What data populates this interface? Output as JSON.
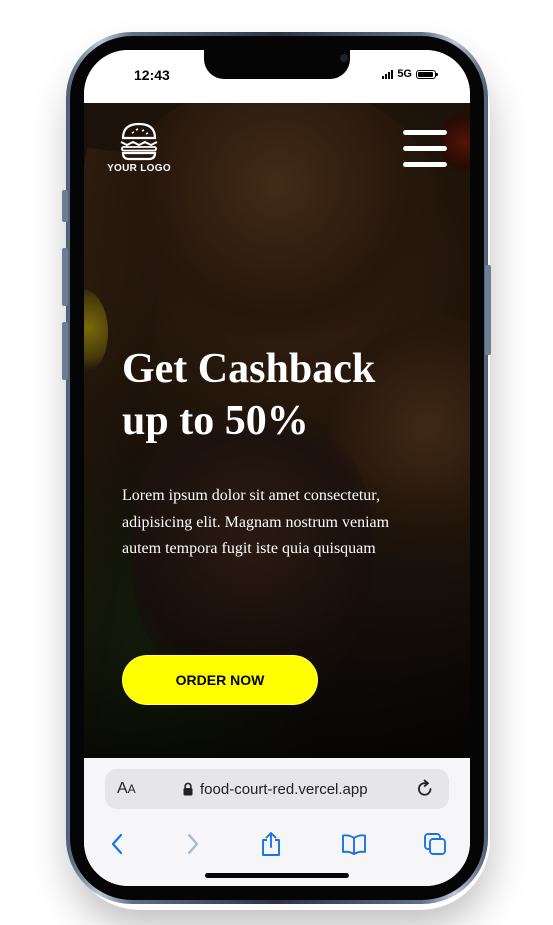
{
  "status_bar": {
    "time": "12:43",
    "network": "5G"
  },
  "hero": {
    "logo_text": "YOUR LOGO",
    "headline_line1": "Get Cashback",
    "headline_line2": "up to 50%",
    "description": "Lorem ipsum dolor sit amet consectetur, adipisicing elit. Magnam nostrum veniam autem tempora fugit iste quia quisquam",
    "cta_label": "ORDER NOW"
  },
  "browser": {
    "text_size_large": "A",
    "text_size_small": "A",
    "url": "food-court-red.vercel.app"
  },
  "colors": {
    "cta_background": "#ffff00",
    "cta_text": "#000000",
    "toolbar_active": "#1a73e8",
    "toolbar_inactive": "#a8b7d4",
    "browser_background": "#f6f6f8",
    "address_bar": "#e5e5ea"
  },
  "icons": {
    "logo": "burger-icon",
    "menu": "hamburger-menu-icon",
    "lock": "lock-icon",
    "reload": "reload-icon",
    "back": "chevron-left-icon",
    "forward": "chevron-right-icon",
    "share": "share-icon",
    "bookmarks": "book-icon",
    "tabs": "tabs-icon"
  }
}
